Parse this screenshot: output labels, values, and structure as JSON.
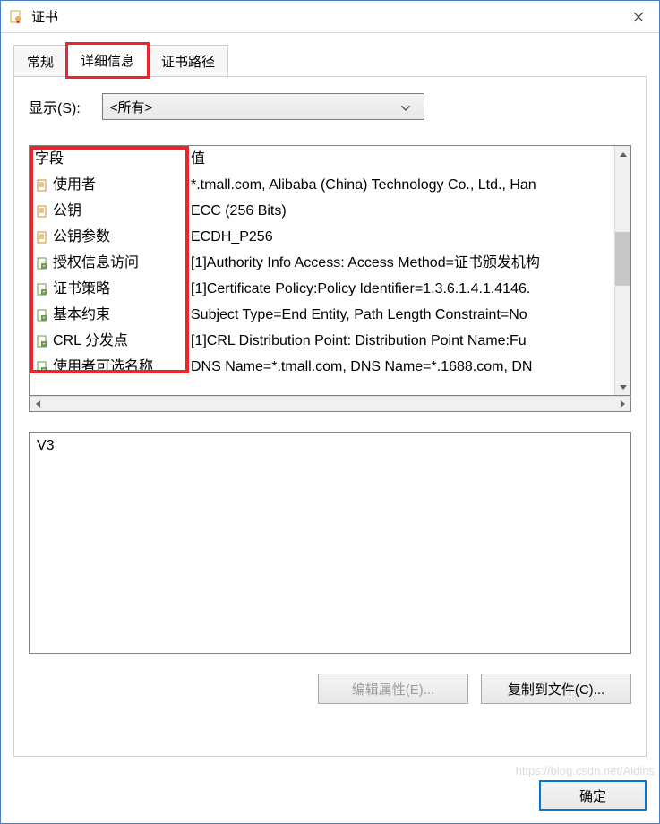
{
  "window": {
    "title": "证书"
  },
  "tabs": [
    {
      "label": "常规",
      "active": false
    },
    {
      "label": "详细信息",
      "active": true
    },
    {
      "label": "证书路径",
      "active": false
    }
  ],
  "filter": {
    "label": "显示(S):",
    "selected": "<所有>"
  },
  "table": {
    "header_field": "字段",
    "header_value": "值",
    "rows": [
      {
        "icon": "doc",
        "field": "使用者",
        "value": "*.tmall.com, Alibaba (China) Technology Co., Ltd., Han"
      },
      {
        "icon": "doc",
        "field": "公钥",
        "value": "ECC (256 Bits)"
      },
      {
        "icon": "doc",
        "field": "公钥参数",
        "value": "ECDH_P256"
      },
      {
        "icon": "ext",
        "field": "授权信息访问",
        "value": "[1]Authority Info Access: Access Method=证书颁发机构"
      },
      {
        "icon": "ext",
        "field": "证书策略",
        "value": "[1]Certificate Policy:Policy Identifier=1.3.6.1.4.1.4146."
      },
      {
        "icon": "ext",
        "field": "基本约束",
        "value": "Subject Type=End Entity, Path Length Constraint=No"
      },
      {
        "icon": "ext",
        "field": "CRL 分发点",
        "value": "[1]CRL Distribution Point: Distribution Point Name:Fu"
      },
      {
        "icon": "ext",
        "field": "使用者可选名称",
        "value": "DNS Name=*.tmall.com, DNS Name=*.1688.com, DN"
      }
    ]
  },
  "detail_value": "V3",
  "buttons": {
    "edit_properties": "编辑属性(E)...",
    "copy_to_file": "复制到文件(C)...",
    "ok": "确定"
  },
  "watermark": "https://blog.csdn.net/Aidins"
}
